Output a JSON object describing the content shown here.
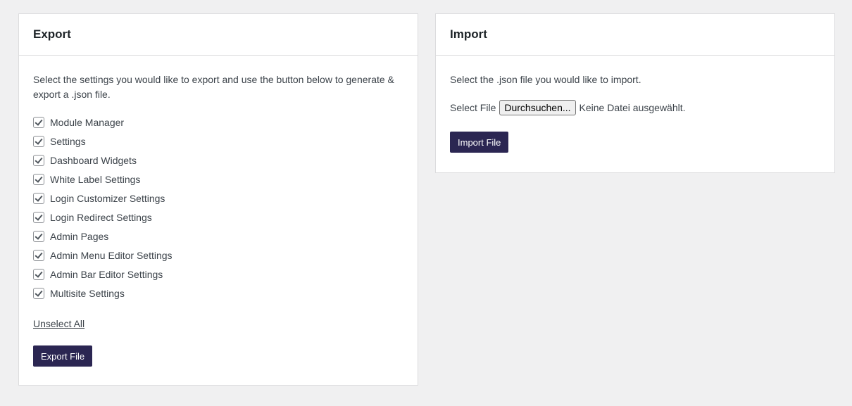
{
  "export": {
    "title": "Export",
    "description": "Select the settings you would like to export and use the button below to generate & export a .json file.",
    "items": [
      {
        "label": "Module Manager",
        "checked": true
      },
      {
        "label": "Settings",
        "checked": true
      },
      {
        "label": "Dashboard Widgets",
        "checked": true
      },
      {
        "label": "White Label Settings",
        "checked": true
      },
      {
        "label": "Login Customizer Settings",
        "checked": true
      },
      {
        "label": "Login Redirect Settings",
        "checked": true
      },
      {
        "label": "Admin Pages",
        "checked": true
      },
      {
        "label": "Admin Menu Editor Settings",
        "checked": true
      },
      {
        "label": "Admin Bar Editor Settings",
        "checked": true
      },
      {
        "label": "Multisite Settings",
        "checked": true
      }
    ],
    "unselect_label": "Unselect All",
    "button_label": "Export File"
  },
  "import": {
    "title": "Import",
    "description": "Select the .json file you would like to import.",
    "file_label": "Select File",
    "browse_label": "Durchsuchen...",
    "file_status": "Keine Datei ausgewählt.",
    "button_label": "Import File"
  },
  "colors": {
    "button": "#2b2652",
    "background": "#f0f0f1"
  }
}
